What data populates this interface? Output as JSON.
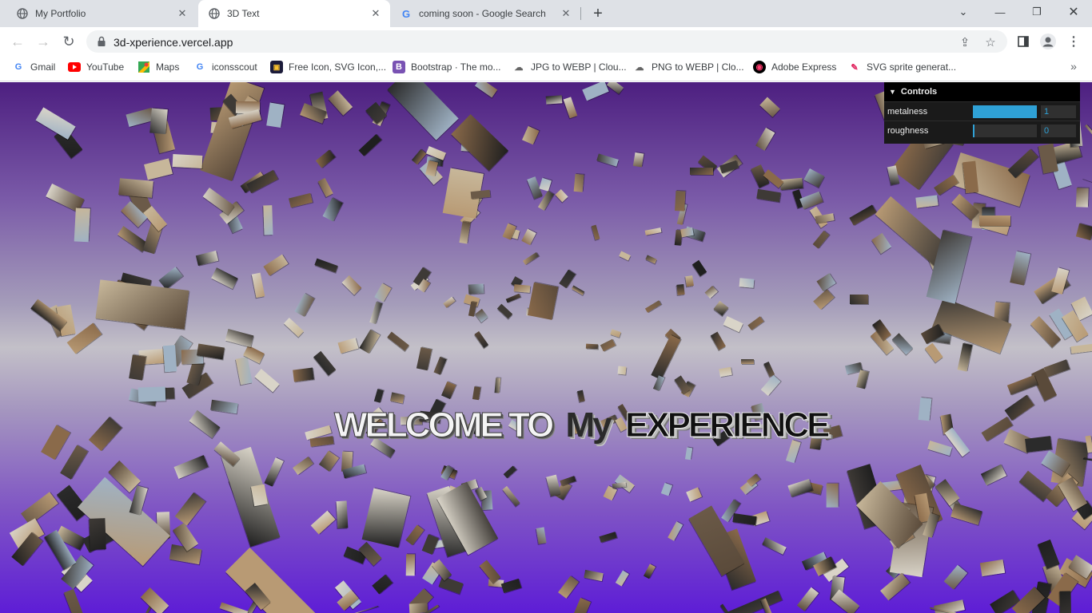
{
  "tabs": [
    {
      "title": "My Portfolio",
      "icon": "globe-icon",
      "active": false
    },
    {
      "title": "3D Text",
      "icon": "globe-icon",
      "active": true
    },
    {
      "title": "coming soon - Google Search",
      "icon": "google-icon",
      "active": false
    }
  ],
  "address_bar": {
    "url": "3d-xperience.vercel.app"
  },
  "bookmarks": [
    {
      "label": "Gmail",
      "icon": "google-icon"
    },
    {
      "label": "YouTube",
      "icon": "youtube-icon"
    },
    {
      "label": "Maps",
      "icon": "maps-icon"
    },
    {
      "label": "iconsscout",
      "icon": "google-icon"
    },
    {
      "label": "Free Icon, SVG Icon,...",
      "icon": "free-icon-icon"
    },
    {
      "label": "Bootstrap · The mo...",
      "icon": "bootstrap-icon"
    },
    {
      "label": "JPG to WEBP | Clou...",
      "icon": "cloud-icon"
    },
    {
      "label": "PNG to WEBP | Clo...",
      "icon": "cloud-icon"
    },
    {
      "label": "Adobe Express",
      "icon": "adobe-icon"
    },
    {
      "label": "SVG sprite generat...",
      "icon": "svg-sprite-icon"
    }
  ],
  "scene": {
    "headline": {
      "part1": "WELCOME TO",
      "part2": "My",
      "part3": "EXPERIENCE"
    }
  },
  "controls": {
    "title": "Controls",
    "metalness": {
      "label": "metalness",
      "value": "1",
      "fraction": 1
    },
    "roughness": {
      "label": "roughness",
      "value": "0",
      "fraction": 0
    }
  },
  "colors": {
    "tab_bar": "#dee1e6",
    "gui_accent": "#2fa1d6",
    "scene_top": "#4d1f80",
    "scene_bottom": "#5e1dd6"
  }
}
